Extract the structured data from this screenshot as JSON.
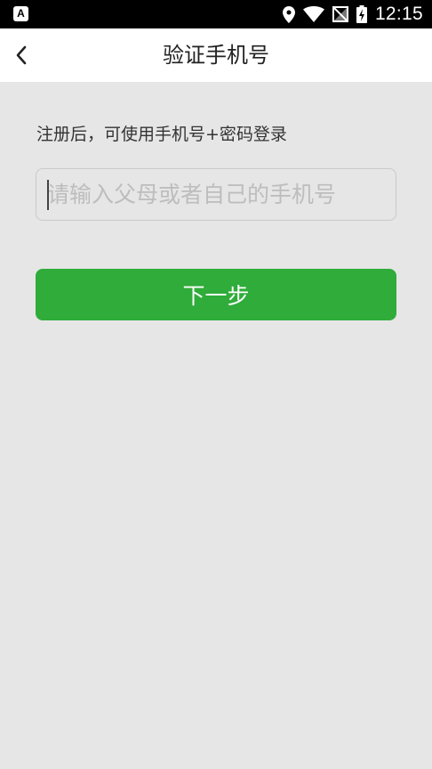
{
  "status_bar": {
    "app_badge": "A",
    "time": "12:15",
    "icons": [
      "location-icon",
      "wifi-icon",
      "no-signal-icon",
      "battery-charging-icon"
    ]
  },
  "header": {
    "back_icon": "chevron-left-icon",
    "title": "验证手机号"
  },
  "form": {
    "hint": "注册后，可使用手机号+密码登录",
    "phone_placeholder": "请输入父母或者自己的手机号",
    "phone_value": "",
    "next_label": "下一步"
  },
  "colors": {
    "primary": "#2fac3a",
    "background": "#e6e6e6",
    "header_bg": "#ffffff"
  }
}
